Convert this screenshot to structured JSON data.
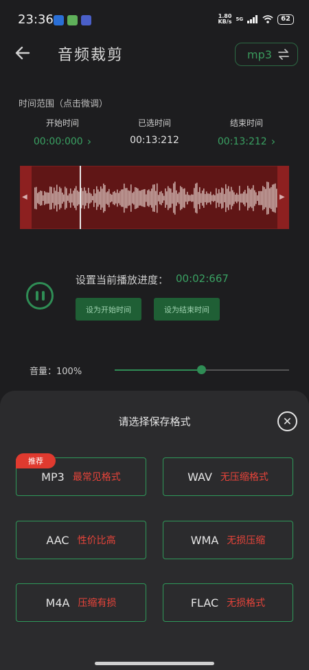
{
  "status_bar": {
    "time": "23:36",
    "net_speed_value": "1.80",
    "net_speed_unit": "KB/s",
    "network": "5G",
    "battery": "62"
  },
  "header": {
    "title": "音频裁剪",
    "format": "mp3"
  },
  "time_range": {
    "title": "时间范围（点击微调）",
    "start_label": "开始时间",
    "start_value": "00:00:000",
    "selected_label": "已选时间",
    "selected_value": "00:13:212",
    "end_label": "结束时间",
    "end_value": "00:13:212"
  },
  "playback": {
    "progress_label": "设置当前播放进度：",
    "progress_value": "00:02:667",
    "set_start_label": "设为开始时间",
    "set_end_label": "设为结束时间"
  },
  "volume": {
    "label": "音量：100%",
    "level": 0.5
  },
  "sheet": {
    "title": "请选择保存格式",
    "badge": "推荐",
    "options": [
      {
        "format": "MP3",
        "desc": "最常见格式"
      },
      {
        "format": "WAV",
        "desc": "无压缩格式"
      },
      {
        "format": "AAC",
        "desc": "性价比高"
      },
      {
        "format": "WMA",
        "desc": "无损压缩"
      },
      {
        "format": "M4A",
        "desc": "压缩有损"
      },
      {
        "format": "FLAC",
        "desc": "无损格式"
      }
    ]
  },
  "colors": {
    "accent": "#2f9a5a",
    "desc_red": "#e8443a",
    "waveform_bg": "#601616"
  }
}
